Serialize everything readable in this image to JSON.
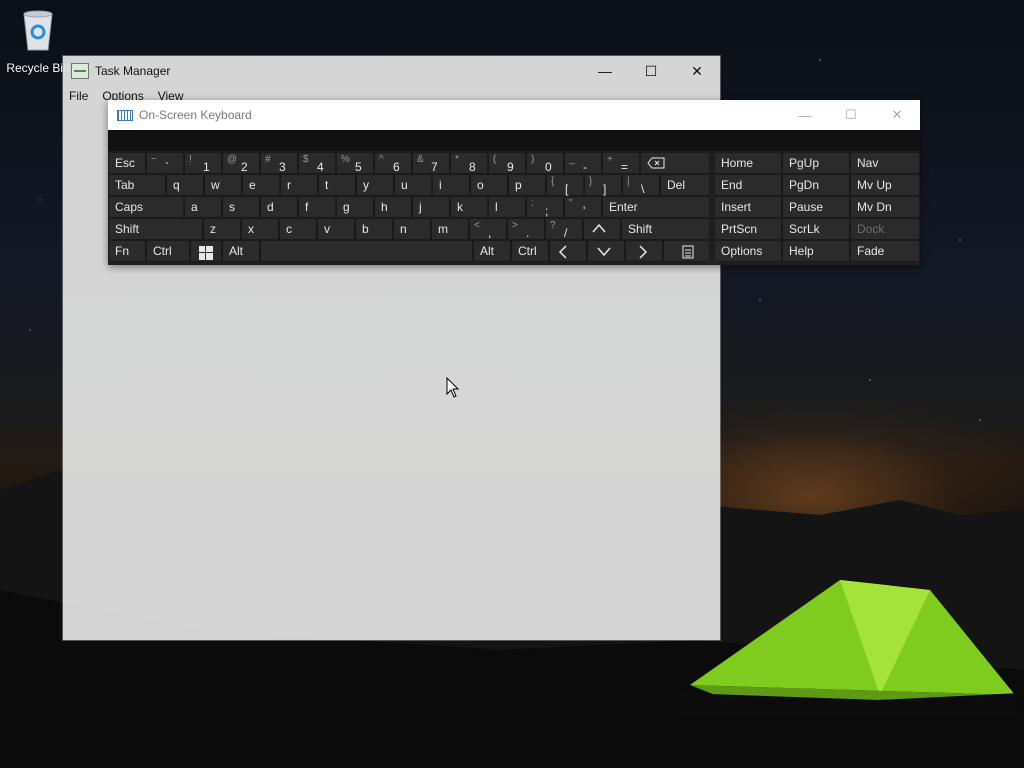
{
  "desktop": {
    "recycle_bin_label": "Recycle Bin"
  },
  "task_manager": {
    "title": "Task Manager",
    "menu": [
      "File",
      "Options",
      "View"
    ],
    "buttons": {
      "minimize": "—",
      "maximize": "☐",
      "close": "✕"
    }
  },
  "osk": {
    "title": "On-Screen Keyboard",
    "buttons": {
      "minimize": "—",
      "maximize": "☐",
      "close": "✕"
    },
    "keys": {
      "esc": "Esc",
      "tab": "Tab",
      "caps": "Caps",
      "shift": "Shift",
      "shift_r": "Shift",
      "fn": "Fn",
      "ctrl": "Ctrl",
      "alt": "Alt",
      "alt_r": "Alt",
      "ctrl_r": "Ctrl",
      "del": "Del",
      "enter": "Enter",
      "num": [
        {
          "sub": "~",
          "main": "`"
        },
        {
          "sub": "!",
          "main": "1"
        },
        {
          "sub": "@",
          "main": "2"
        },
        {
          "sub": "#",
          "main": "3"
        },
        {
          "sub": "$",
          "main": "4"
        },
        {
          "sub": "%",
          "main": "5"
        },
        {
          "sub": "^",
          "main": "6"
        },
        {
          "sub": "&",
          "main": "7"
        },
        {
          "sub": "*",
          "main": "8"
        },
        {
          "sub": "(",
          "main": "9"
        },
        {
          "sub": ")",
          "main": "0"
        },
        {
          "sub": "_",
          "main": "-"
        },
        {
          "sub": "+",
          "main": "="
        }
      ],
      "row_q": [
        "q",
        "w",
        "e",
        "r",
        "t",
        "y",
        "u",
        "i",
        "o",
        "p"
      ],
      "row_q_sym": [
        {
          "sub": "{",
          "main": "["
        },
        {
          "sub": "}",
          "main": "]"
        },
        {
          "sub": "|",
          "main": "\\"
        }
      ],
      "row_a": [
        "a",
        "s",
        "d",
        "f",
        "g",
        "h",
        "j",
        "k",
        "l"
      ],
      "row_a_sym": [
        {
          "sub": ":",
          "main": ";"
        },
        {
          "sub": "\"",
          "main": "'"
        }
      ],
      "row_z": [
        "z",
        "x",
        "c",
        "v",
        "b",
        "n",
        "m"
      ],
      "row_z_sym": [
        {
          "sub": "<",
          "main": ","
        },
        {
          "sub": ">",
          "main": "."
        },
        {
          "sub": "?",
          "main": "/"
        }
      ],
      "nav": [
        [
          "Home",
          "PgUp",
          "Nav"
        ],
        [
          "End",
          "PgDn",
          "Mv Up"
        ],
        [
          "Insert",
          "Pause",
          "Mv Dn"
        ],
        [
          "PrtScn",
          "ScrLk",
          "Dock"
        ],
        [
          "Options",
          "Help",
          "Fade"
        ]
      ]
    }
  }
}
